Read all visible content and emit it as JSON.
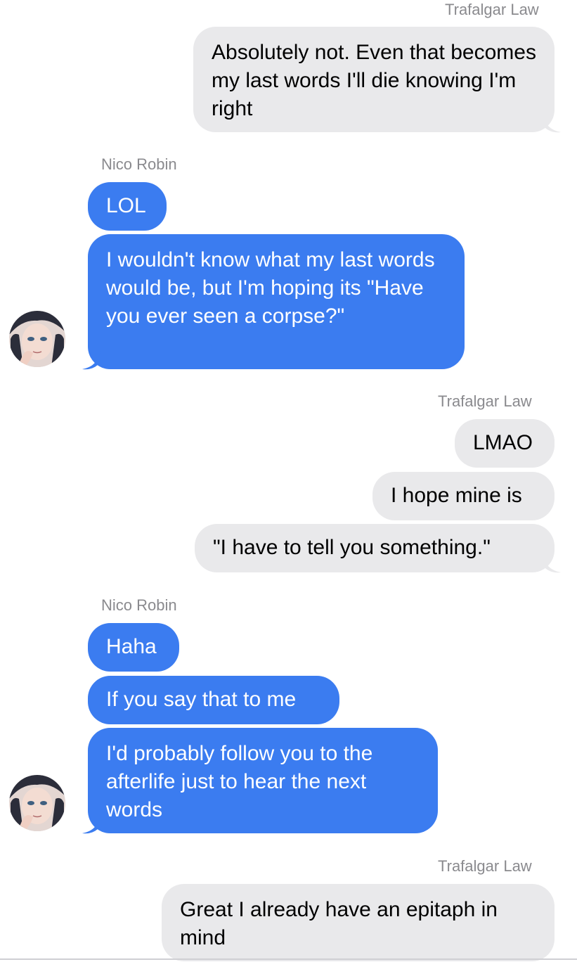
{
  "participants": {
    "me": "Trafalgar Law",
    "other": "Nico Robin"
  },
  "colors": {
    "outgoing_bg": "#e9e9eb",
    "incoming_bg": "#3b7cf0",
    "name_text": "#8a8a8e"
  },
  "messages": [
    {
      "sender": "Trafalgar Law",
      "text": "Absolutely not. Even that becomes my last words I'll die knowing I'm right"
    },
    {
      "sender": "Nico Robin",
      "text": "LOL"
    },
    {
      "sender": "Nico Robin",
      "text": "I wouldn't know what my last words would be, but I'm hoping its \"Have you ever seen a corpse?\""
    },
    {
      "sender": "Trafalgar Law",
      "text": "LMAO"
    },
    {
      "sender": "Trafalgar Law",
      "text": "I hope mine is"
    },
    {
      "sender": "Trafalgar Law",
      "text": "\"I have to tell you something.\""
    },
    {
      "sender": "Nico Robin",
      "text": "Haha"
    },
    {
      "sender": "Nico Robin",
      "text": "If you say that to me"
    },
    {
      "sender": "Nico Robin",
      "text": "I'd probably follow you to the afterlife just to hear the next words"
    },
    {
      "sender": "Trafalgar Law",
      "text": "Great I already have an epitaph in mind"
    }
  ],
  "icons": {
    "avatar": "nico-robin-avatar-icon"
  }
}
